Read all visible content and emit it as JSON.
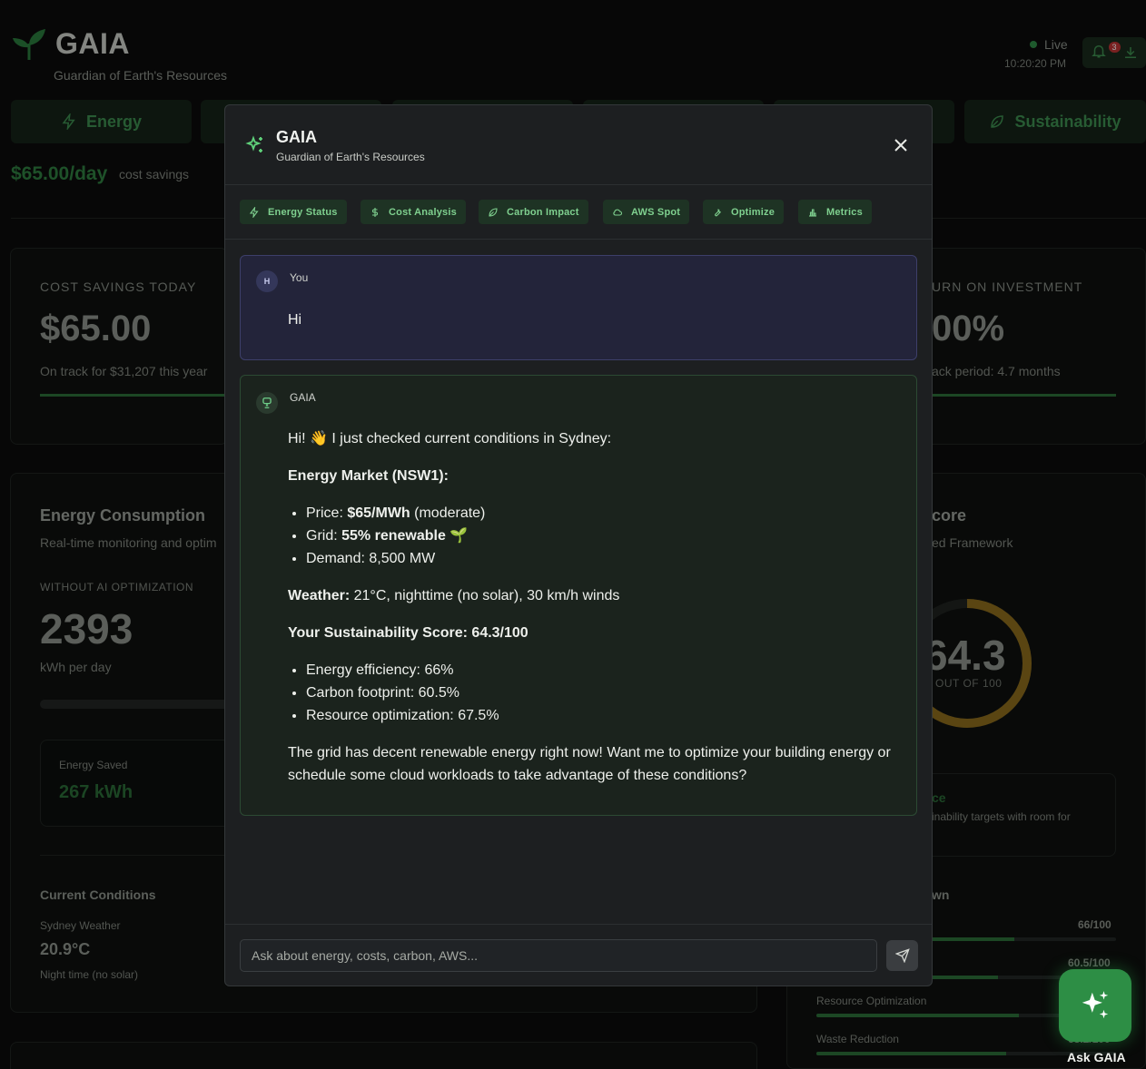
{
  "app": {
    "title": "GAIA",
    "subtitle": "Guardian of Earth's Resources",
    "live_label": "Live",
    "clock": "10:20:20 PM",
    "notification_count": "3"
  },
  "tabs": [
    {
      "label": "Energy"
    },
    {
      "label": "Sustainability"
    }
  ],
  "savings_banner": {
    "value": "$65.00/day",
    "label": "cost savings"
  },
  "cost_card": {
    "caption": "COST SAVINGS TODAY",
    "value": "$65.00",
    "note": "On track for $31,207 this year"
  },
  "roi_card": {
    "caption": "URN ON INVESTMENT",
    "value": "00%",
    "note": "ack period: 4.7 months"
  },
  "energy_card": {
    "title": "Energy Consumption",
    "subtitle": "Real-time monitoring and optim",
    "caption": "WITHOUT AI OPTIMIZATION",
    "value": "2393",
    "unit": "kWh per day",
    "saved_label": "Energy Saved",
    "saved_value": "267 kWh",
    "conditions_title": "Current Conditions",
    "weather_label": "Sydney Weather",
    "temp": "20.9°C",
    "weather_note": "Night time (no solar)"
  },
  "score_card": {
    "title": "core",
    "subtitle": "ed Framework",
    "score": "64.3",
    "score_display": "64.3",
    "score_caption": "OUT OF 100",
    "score_fraction": 0.643,
    "rating_title": "ce",
    "rating_text": "inability targets with room for",
    "breakdown_title": "wn",
    "rows": [
      {
        "label": "",
        "value": "66/100",
        "fraction": 0.66
      },
      {
        "label": "",
        "value": "60.5/100",
        "fraction": 0.605
      },
      {
        "label": "Resource Optimization",
        "value": "",
        "fraction": 0.675
      },
      {
        "label": "Waste Reduction",
        "value": "63.2/100",
        "fraction": 0.632
      }
    ]
  },
  "dialog": {
    "title": "GAIA",
    "subtitle": "Guardian of Earth's Resources",
    "chips": [
      {
        "label": "Energy Status",
        "icon": "bolt-icon"
      },
      {
        "label": "Cost Analysis",
        "icon": "dollar-icon"
      },
      {
        "label": "Carbon Impact",
        "icon": "leaf-icon"
      },
      {
        "label": "AWS Spot",
        "icon": "cloud-icon"
      },
      {
        "label": "Optimize",
        "icon": "wrench-icon"
      },
      {
        "label": "Metrics",
        "icon": "chart-icon"
      }
    ],
    "user_message": {
      "avatar": "H",
      "sender": "You",
      "text": "Hi"
    },
    "bot_message": {
      "sender": "GAIA",
      "greeting": "Hi! 👋 I just checked current conditions in Sydney:",
      "market_heading": "Energy Market (NSW1):",
      "market_items": [
        {
          "label": "Price: ",
          "bold": "$65/MWh",
          "rest": " (moderate)"
        },
        {
          "label": "Grid: ",
          "bold": "55% renewable",
          "rest": " 🌱"
        },
        {
          "label": "Demand: 8,500 MW",
          "bold": "",
          "rest": ""
        }
      ],
      "weather_label": "Weather:",
      "weather_text": " 21°C, nighttime (no solar), 30 km/h winds",
      "score_heading": "Your Sustainability Score: 64.3/100",
      "score_items": [
        "Energy efficiency: 66%",
        "Carbon footprint: 60.5%",
        "Resource optimization: 67.5%"
      ],
      "closing": "The grid has decent renewable energy right now! Want me to optimize your building energy or schedule some cloud workloads to take advantage of these conditions?"
    },
    "input_placeholder": "Ask about energy, costs, carbon, AWS..."
  },
  "fab": {
    "label": "Ask GAIA"
  },
  "colors": {
    "accent": "#2d8e45",
    "chip_text": "#7fd08f",
    "user_bubble": "#23243a",
    "bot_bubble": "#1b231d",
    "donut": "#8a6a1c"
  }
}
